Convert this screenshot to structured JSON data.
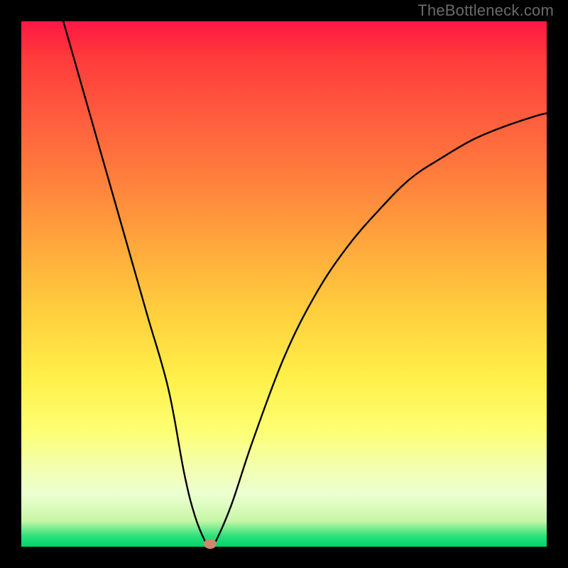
{
  "watermark": "TheBottleneck.com",
  "chart_data": {
    "type": "line",
    "title": "",
    "xlabel": "",
    "ylabel": "",
    "xlim": [
      0,
      100
    ],
    "ylim": [
      0,
      100
    ],
    "background_gradient": {
      "top": "#ff1744",
      "mid": "#ffeb3b",
      "bottom": "#00d56a"
    },
    "series": [
      {
        "name": "bottleneck-curve",
        "x": [
          8,
          12,
          16,
          20,
          24,
          28,
          31,
          33,
          35,
          36,
          37,
          40,
          44,
          50,
          56,
          62,
          68,
          74,
          80,
          86,
          92,
          98,
          100
        ],
        "values": [
          100,
          86,
          72,
          58,
          44,
          30,
          14,
          6,
          1,
          0,
          1,
          8,
          20,
          36,
          48,
          57,
          64,
          70,
          74,
          77.5,
          80,
          82,
          82.5
        ]
      }
    ],
    "annotations": [
      {
        "name": "optimum-marker",
        "x": 36,
        "y": 0.5,
        "color": "#cf866d"
      }
    ]
  }
}
